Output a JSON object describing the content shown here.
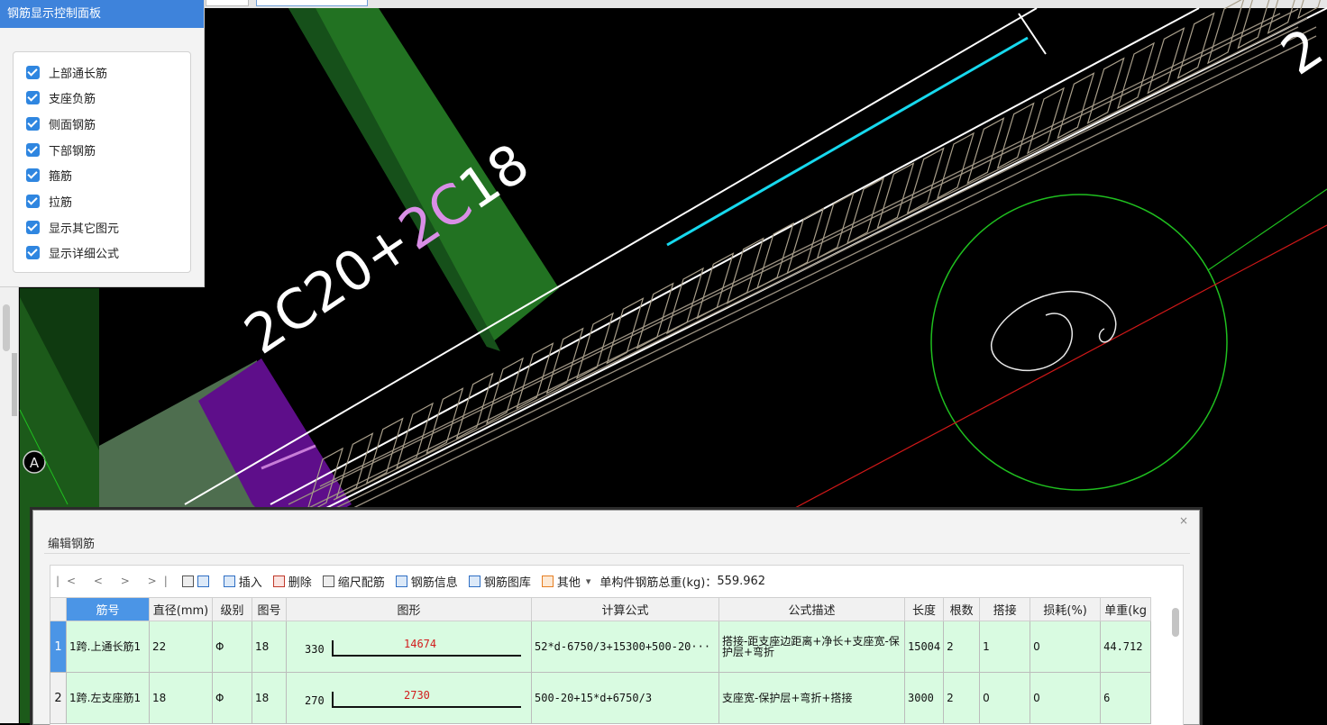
{
  "canvas": {
    "text_rebar_a": "2C20+",
    "text_rebar_b": "2C",
    "text_rebar_c": "18",
    "text_right_cut": "2",
    "axis_label": "A"
  },
  "control_panel": {
    "title": "钢筋显示控制面板",
    "items": [
      {
        "label": "上部通长筋",
        "checked": true
      },
      {
        "label": "支座负筋",
        "checked": true
      },
      {
        "label": "侧面钢筋",
        "checked": true
      },
      {
        "label": "下部钢筋",
        "checked": true
      },
      {
        "label": "箍筋",
        "checked": true
      },
      {
        "label": "拉筋",
        "checked": true
      },
      {
        "label": "显示其它图元",
        "checked": true
      },
      {
        "label": "显示详细公式",
        "checked": true
      }
    ]
  },
  "dialog": {
    "title": "编辑钢筋",
    "close_glyph": "×",
    "nav": "|<  <  >  >|",
    "toolbar": {
      "insert": "插入",
      "delete": "删除",
      "scale": "缩尺配筋",
      "info": "钢筋信息",
      "library": "钢筋图库",
      "other": "其他",
      "other_caret": "▾",
      "total_label": "单构件钢筋总重(kg)：",
      "total_value": "559.962"
    },
    "columns": [
      "筋号",
      "直径(mm)",
      "级别",
      "图号",
      "图形",
      "计算公式",
      "公式描述",
      "长度",
      "根数",
      "搭接",
      "损耗(%)",
      "单重(kg"
    ],
    "rows": [
      {
        "no": "1",
        "name": "1跨.上通长筋1",
        "diameter": "22",
        "grade": "Φ",
        "figure": "18",
        "shape_lead": "330",
        "shape_len": "14674",
        "formula": "52*d-6750/3+15300+500-20···",
        "desc": "搭接-距支座边距离+净长+支座宽-保护层+弯折",
        "length": "15004",
        "count": "2",
        "lap": "1",
        "loss": "0",
        "unit_weight": "44.712"
      },
      {
        "no": "2",
        "name": "1跨.左支座筋1",
        "diameter": "18",
        "grade": "Φ",
        "figure": "18",
        "shape_lead": "270",
        "shape_len": "2730",
        "formula": "500-20+15*d+6750/3",
        "desc": "支座宽-保护层+弯折+搭接",
        "length": "3000",
        "count": "2",
        "lap": "0",
        "loss": "0",
        "unit_weight": "6"
      }
    ]
  },
  "colors": {
    "beam_green": "#1f6f1c",
    "column_purple": "#5e0e8a",
    "rebar_cyan": "#17d9ee",
    "label_pink": "#d98ee6",
    "header_blue": "#4b95e6",
    "row_green": "#d9fbe1",
    "panel_blue": "#3e83db"
  }
}
